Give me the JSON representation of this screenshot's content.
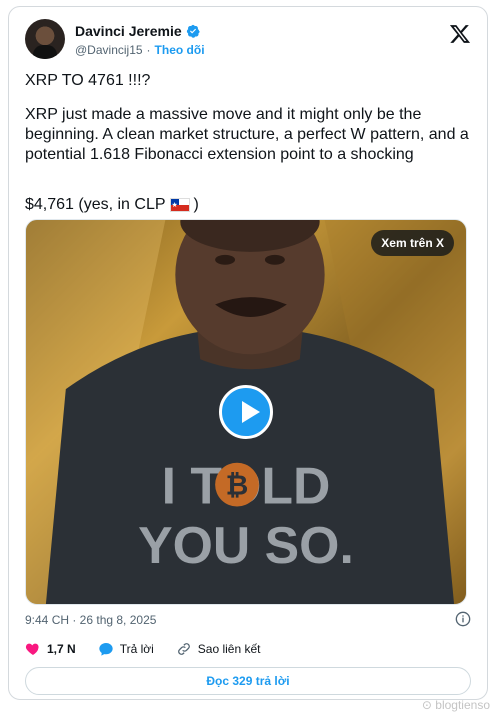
{
  "tweet": {
    "author_name": "Davinci Jeremie",
    "handle": "@Davincij15",
    "separator": "·",
    "follow_label": "Theo dõi",
    "line1": "XRP TO 4761 !!!?",
    "body": "XRP just made a massive move  and it might only be the beginning. A clean market structure, a perfect W pattern, and a potential 1.618 Fibonacci extension point to a shocking",
    "price_line": "$4,761 (yes, in CLP",
    "price_close": ")",
    "media": {
      "watch_label": "Xem trên X",
      "shirt_line1": "I TOLD",
      "shirt_line2": "YOU SO."
    },
    "timestamp": "9:44 CH · 26 thg 8, 2025",
    "likes": "1,7 N",
    "reply_label": "Trả lời",
    "copy_link_label": "Sao liên kết",
    "read_replies_label": "Đọc 329 trả lời"
  },
  "watermark": "blogtienso",
  "icons": {
    "verified": "verified-badge-icon",
    "logo": "x-logo-icon",
    "heart": "heart-icon",
    "reply": "reply-bubble-icon",
    "link": "link-icon",
    "info": "info-icon",
    "flag": "chile-flag-icon"
  },
  "colors": {
    "accent": "#1d9bf0",
    "like": "#f91880",
    "muted": "#536471"
  }
}
